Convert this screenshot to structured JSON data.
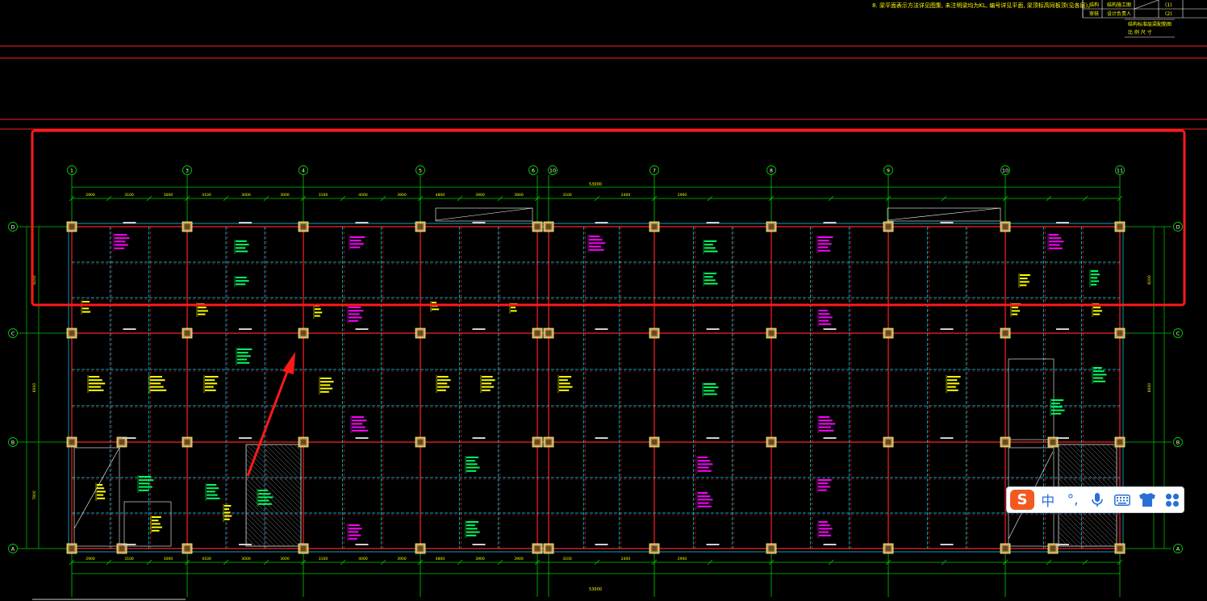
{
  "drawing": {
    "note_line": "8. 梁平面表示方法详见图集, 未注明梁均为KL, 编号详见平面, 梁顶标高同板顶(见各层)。",
    "title_block": {
      "rows": [
        [
          "结构",
          "结构施工图",
          "(1)"
        ],
        [
          "审核",
          "设计负责人",
          "(2)"
        ]
      ],
      "caption": "结构标准层梁配筋图",
      "sub_caption": "比 例 尺 寸"
    },
    "grid_columns": [
      "1",
      "3",
      "4",
      "5",
      "6",
      "10",
      "7",
      "8",
      "9",
      "10",
      "11"
    ],
    "grid_rows": [
      "D",
      "C",
      "B",
      "A"
    ],
    "top_total_dim": "53000",
    "bottom_total_dim": "53000",
    "left_dims": [
      "8200",
      "6000",
      "7800"
    ],
    "span_dims": [
      "2900",
      "3100",
      "3000",
      "4100",
      "3000",
      "3000",
      "3100",
      "4000",
      "3900",
      "4800",
      "3900",
      "3900",
      "3100",
      "2400",
      "2900"
    ],
    "colors": {
      "background": "#000000",
      "axis": "#00cc00",
      "beam_red": "#ff2020",
      "beam_cyan": "#00e0ff",
      "column_fill": "#c8a060",
      "annot_yellow": "#ffff00",
      "annot_magenta": "#ff00ff",
      "annot_green": "#00ff60",
      "highlight": "#ff1a1a"
    }
  },
  "annotations": {
    "highlight_box": "highlight-rectangle",
    "arrow": "pointer-arrow"
  },
  "ime_toolbar": {
    "logo": "S",
    "mode": "中",
    "punct": "°,",
    "icons": [
      "microphone-icon",
      "keyboard-icon",
      "shirt-icon",
      "apps-icon"
    ]
  }
}
